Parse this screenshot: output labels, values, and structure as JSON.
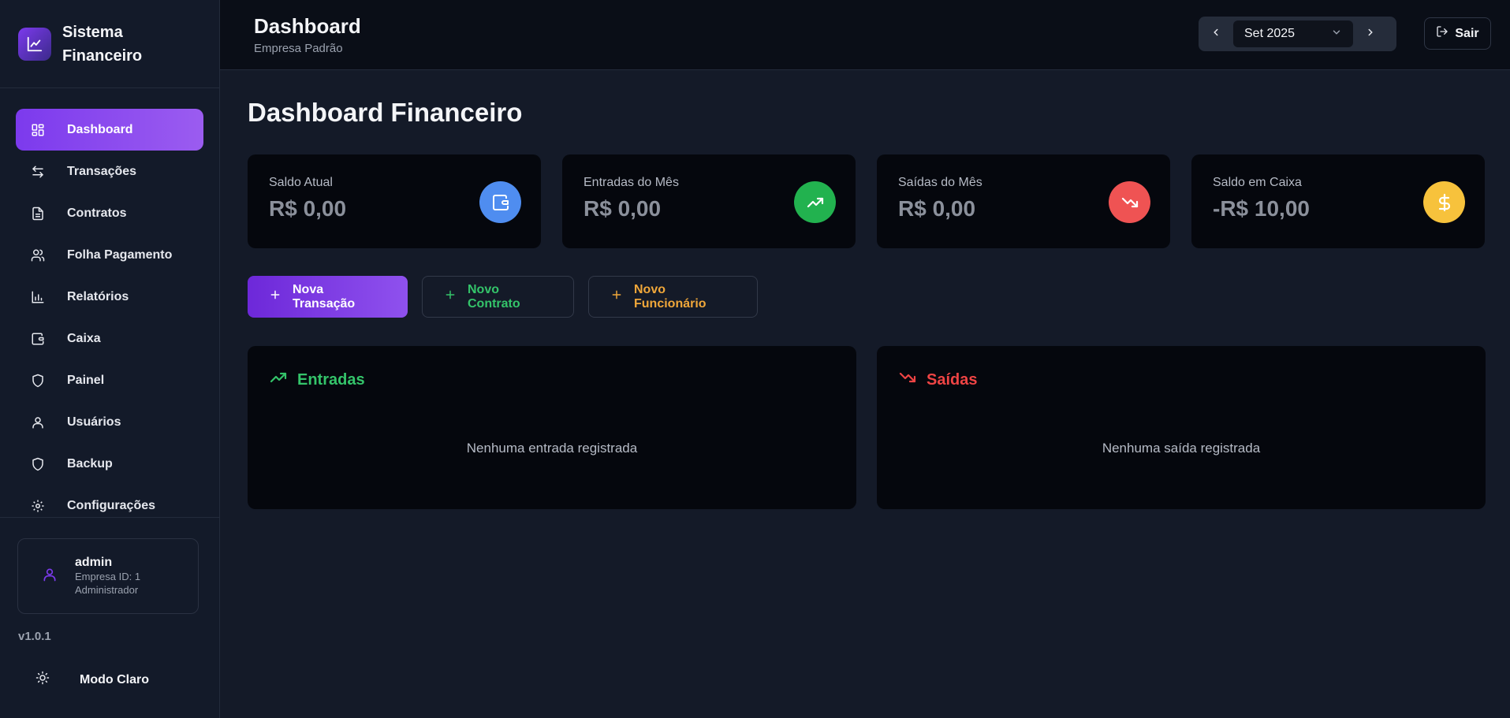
{
  "brand": {
    "title": "Sistema Financeiro"
  },
  "sidebar": {
    "items": [
      {
        "label": "Dashboard",
        "icon": "grid-icon"
      },
      {
        "label": "Transações",
        "icon": "arrows-swap-icon"
      },
      {
        "label": "Contratos",
        "icon": "document-icon"
      },
      {
        "label": "Folha Pagamento",
        "icon": "users-icon"
      },
      {
        "label": "Relatórios",
        "icon": "bar-chart-icon"
      },
      {
        "label": "Caixa",
        "icon": "wallet-icon"
      },
      {
        "label": "Painel",
        "icon": "shield-icon"
      },
      {
        "label": "Usuários",
        "icon": "user-icon"
      },
      {
        "label": "Backup",
        "icon": "shield-icon"
      },
      {
        "label": "Configurações",
        "icon": "gear-icon"
      }
    ],
    "active_index": 0
  },
  "user": {
    "name": "admin",
    "company": "Empresa ID: 1",
    "role": "Administrador"
  },
  "version": "v1.0.1",
  "theme_toggle": {
    "label": "Modo Claro"
  },
  "topbar": {
    "title": "Dashboard",
    "subtitle": "Empresa Padrão",
    "month": "Set 2025",
    "logout_label": "Sair"
  },
  "page": {
    "title": "Dashboard Financeiro"
  },
  "stats": [
    {
      "label": "Saldo Atual",
      "value": "R$ 0,00",
      "icon": "wallet-icon",
      "color": "#4f8df0"
    },
    {
      "label": "Entradas do Mês",
      "value": "R$ 0,00",
      "icon": "trending-up-icon",
      "color": "#22b24f"
    },
    {
      "label": "Saídas do Mês",
      "value": "R$ 0,00",
      "icon": "trending-down-icon",
      "color": "#ef5353"
    },
    {
      "label": "Saldo em Caixa",
      "value": "-R$ 10,00",
      "icon": "dollar-icon",
      "color": "#f7c23c"
    }
  ],
  "actions": {
    "new_transaction": "Nova Transação",
    "new_contract": "Novo Contrato",
    "new_employee": "Novo Funcionário"
  },
  "panels": {
    "income": {
      "title": "Entradas",
      "empty": "Nenhuma entrada registrada",
      "color": "#34c46a"
    },
    "expenses": {
      "title": "Saídas",
      "empty": "Nenhuma saída registrada",
      "color": "#ef4444"
    }
  },
  "colors": {
    "accent": "#7c3aed",
    "background": "#141a28",
    "card": "#05070d"
  }
}
